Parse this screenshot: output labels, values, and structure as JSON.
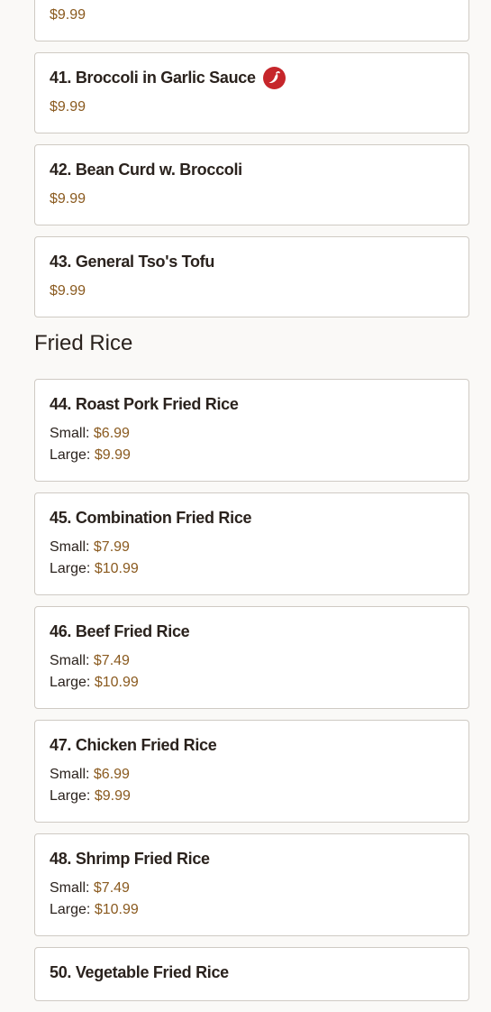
{
  "items_top": [
    {
      "number_name": "",
      "price": "$9.99"
    },
    {
      "number_name": "41. Broccoli in Garlic Sauce",
      "price": "$9.99",
      "spicy": true
    },
    {
      "number_name": "42. Bean Curd w. Broccoli",
      "price": "$9.99"
    },
    {
      "number_name": "43. General Tso's Tofu",
      "price": "$9.99"
    }
  ],
  "fried_rice": {
    "title": "Fried Rice",
    "small_label": "Small:",
    "large_label": "Large:",
    "items": [
      {
        "number_name": "44. Roast Pork Fried Rice",
        "small": "$6.99",
        "large": "$9.99"
      },
      {
        "number_name": "45. Combination Fried Rice",
        "small": "$7.99",
        "large": "$10.99"
      },
      {
        "number_name": "46. Beef Fried Rice",
        "small": "$7.49",
        "large": "$10.99"
      },
      {
        "number_name": "47. Chicken Fried Rice",
        "small": "$6.99",
        "large": "$9.99"
      },
      {
        "number_name": "48. Shrimp Fried Rice",
        "small": "$7.49",
        "large": "$10.99"
      },
      {
        "number_name": "50. Vegetable Fried Rice"
      }
    ]
  },
  "icons": {
    "spicy": "chili-pepper-icon"
  },
  "colors": {
    "price": "#8a5a1f",
    "spicy_badge": "#c6262b",
    "card_border": "#cfcac4",
    "background": "#faf9f7"
  }
}
